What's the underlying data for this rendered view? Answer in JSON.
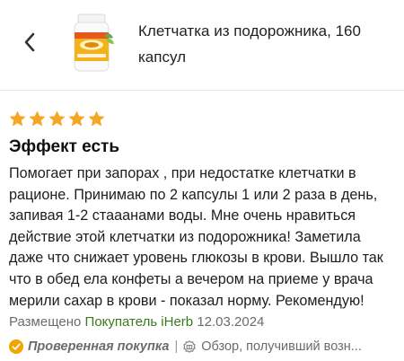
{
  "header": {
    "back_icon": "chevron-left-icon",
    "product_image_icon": "supplement-bottle-icon",
    "product_title": "Клетчатка из подорожника, 160 капсул"
  },
  "review": {
    "rating": 5,
    "rating_max": 5,
    "star_color": "#f5a623",
    "title": "Эффект есть",
    "body": "Помогает при запорах , при недостатке клетчатки в рационе. Принимаю по 2 капсулы 1 или 2 раза в день, запивая 1-2 стааанами воды. Мне очень нравиться действие этой клетчатки из подорожника! Заметила даже что снижает уровень глюкозы в крови. Вышло так что в обед ела конфеты а вечером на приеме у врача мерили сахар в крови - показал норму. Рекомендую!",
    "meta": {
      "posted_label": "Размещено",
      "author": "Покупатель iHerb",
      "date": "12.03.2024",
      "author_color": "#3b7a19"
    },
    "badges": {
      "verified_icon": "verified-check-icon",
      "verified_label": "Проверенная покупка",
      "separator": "|",
      "promo_icon": "gift-badge-icon",
      "promo_label": "Обзор, получивший возн..."
    }
  }
}
